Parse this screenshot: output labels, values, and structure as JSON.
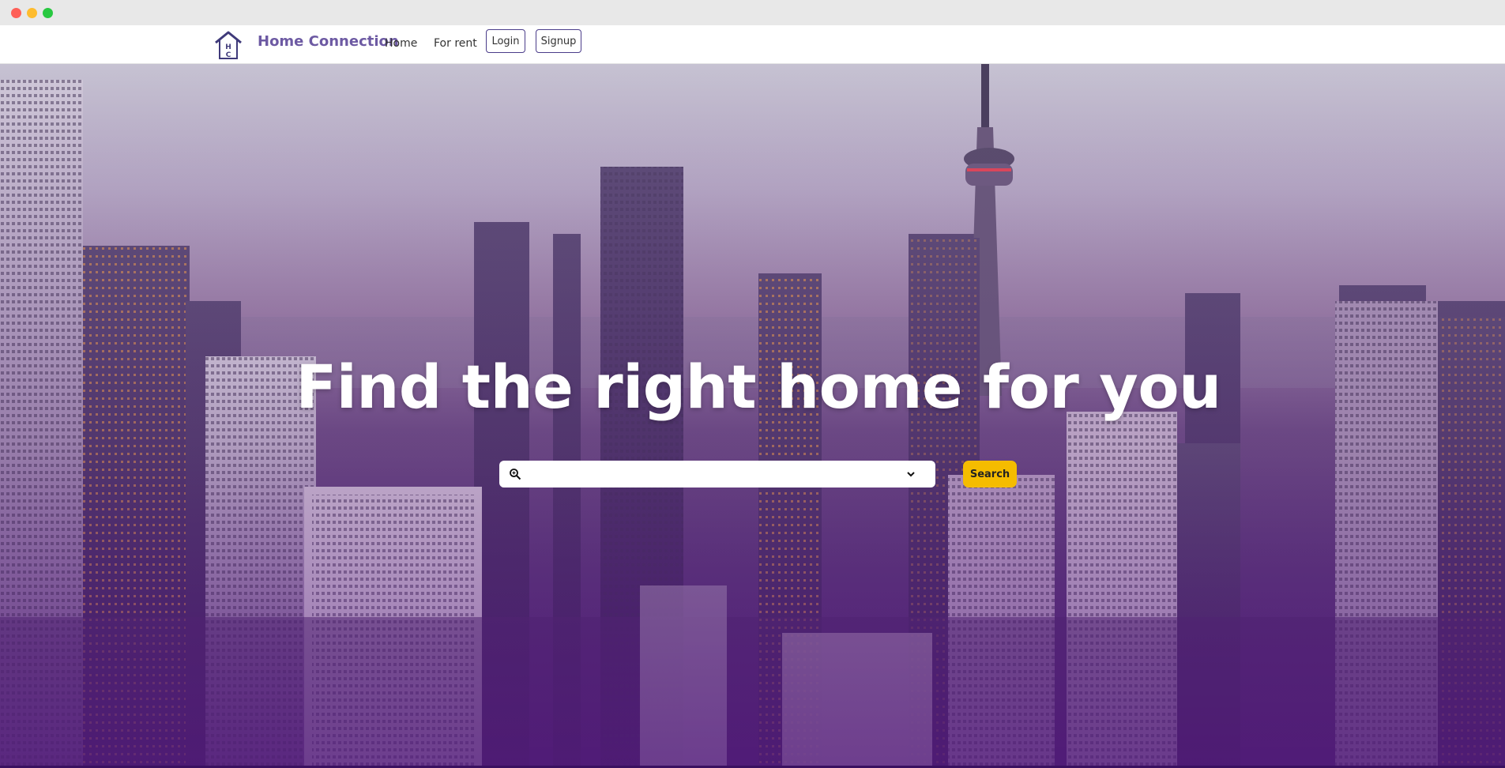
{
  "navbar": {
    "brand": "Home Connection",
    "links": [
      {
        "label": "Home"
      },
      {
        "label": "For rent"
      }
    ],
    "login_label": "Login",
    "signup_label": "Signup"
  },
  "hero": {
    "headline": "Find the right home for you",
    "search": {
      "value": "",
      "placeholder": ""
    },
    "search_button_label": "Search"
  },
  "colors": {
    "brand": "#6d5aa3",
    "accent": "#f5bc00",
    "nav_border": "#4b3d8a"
  },
  "icons": [
    "house-logo-icon",
    "search-icon",
    "chevron-down-icon"
  ]
}
